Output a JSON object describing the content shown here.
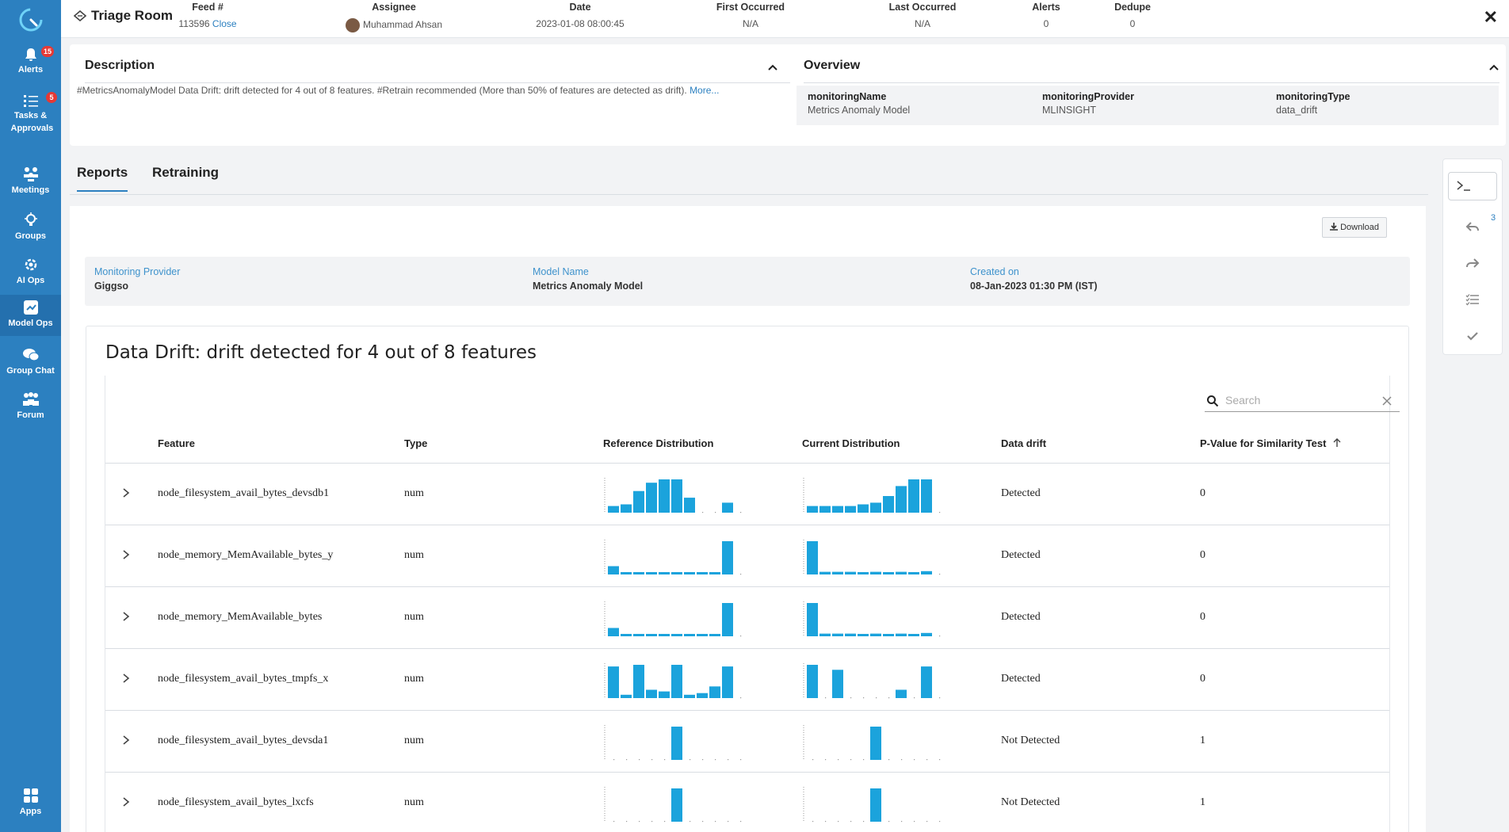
{
  "sidebar": {
    "items": [
      {
        "label": "Alerts",
        "badge": "15"
      },
      {
        "label": "Tasks & Approvals",
        "badge": "5"
      },
      {
        "label": "Meetings"
      },
      {
        "label": "Groups"
      },
      {
        "label": "AI Ops"
      },
      {
        "label": "Model Ops"
      },
      {
        "label": "Group Chat"
      },
      {
        "label": "Forum"
      },
      {
        "label": "Apps"
      }
    ]
  },
  "header": {
    "title": "Triage Room",
    "feed": {
      "label": "Feed #",
      "value": "113596",
      "action": "Close"
    },
    "assignee": {
      "label": "Assignee",
      "value": "Muhammad Ahsan"
    },
    "date": {
      "label": "Date",
      "value": "2023-01-08 08:00:45"
    },
    "first_occurred": {
      "label": "First Occurred",
      "value": "N/A"
    },
    "last_occurred": {
      "label": "Last Occurred",
      "value": "N/A"
    },
    "alerts": {
      "label": "Alerts",
      "value": "0"
    },
    "dedupe": {
      "label": "Dedupe",
      "value": "0"
    }
  },
  "description": {
    "title": "Description",
    "text": "#MetricsAnomalyModel Data Drift: drift detected for 4 out of 8 features. #Retrain recommended (More than 50% of features are detected as drift).",
    "more": "More..."
  },
  "overview": {
    "title": "Overview",
    "fields": [
      {
        "key": "monitoringName",
        "value": "Metrics Anomaly Model"
      },
      {
        "key": "monitoringProvider",
        "value": "MLINSIGHT"
      },
      {
        "key": "monitoringType",
        "value": "data_drift"
      }
    ]
  },
  "tabs": [
    {
      "label": "Reports"
    },
    {
      "label": "Retraining"
    }
  ],
  "report": {
    "download_label": "Download",
    "meta": [
      {
        "key": "Monitoring Provider",
        "value": "Giggso"
      },
      {
        "key": "Model Name",
        "value": "Metrics Anomaly Model"
      },
      {
        "key": "Created on",
        "value": "08-Jan-2023 01:30 PM (IST)"
      }
    ],
    "drift_title": "Data Drift: drift detected for 4 out of 8 features",
    "search_placeholder": "Search",
    "columns": [
      "Feature",
      "Type",
      "Reference Distribution",
      "Current Distribution",
      "Data drift",
      "P-Value for Similarity Test"
    ],
    "rows": [
      {
        "feature": "node_filesystem_avail_bytes_devsdb1",
        "type": "num",
        "drift": "Detected",
        "pvalue": "0",
        "ref": [
          0.2,
          0.25,
          0.65,
          0.9,
          1.0,
          1.0,
          0.45,
          0,
          0,
          0.3,
          0
        ],
        "cur": [
          0.2,
          0.2,
          0.2,
          0.2,
          0.25,
          0.3,
          0.5,
          0.8,
          1.0,
          1.0,
          0
        ]
      },
      {
        "feature": "node_memory_MemAvailable_bytes_y",
        "type": "num",
        "drift": "Detected",
        "pvalue": "0",
        "ref": [
          0.25,
          0.05,
          0.05,
          0.05,
          0.05,
          0.05,
          0.05,
          0.05,
          0.05,
          1.0,
          0
        ],
        "cur": [
          1.0,
          0.08,
          0.08,
          0.08,
          0.06,
          0.08,
          0.06,
          0.08,
          0.06,
          0.1,
          0
        ]
      },
      {
        "feature": "node_memory_MemAvailable_bytes",
        "type": "num",
        "drift": "Detected",
        "pvalue": "0",
        "ref": [
          0.25,
          0.05,
          0.05,
          0.05,
          0.05,
          0.05,
          0.05,
          0.05,
          0.05,
          1.0,
          0
        ],
        "cur": [
          1.0,
          0.08,
          0.08,
          0.08,
          0.06,
          0.08,
          0.06,
          0.08,
          0.06,
          0.1,
          0
        ]
      },
      {
        "feature": "node_filesystem_avail_bytes_tmpfs_x",
        "type": "num",
        "drift": "Detected",
        "pvalue": "0",
        "ref": [
          0.95,
          0.1,
          1.0,
          0.25,
          0.2,
          1.0,
          0.1,
          0.15,
          0.35,
          0.95,
          0
        ],
        "cur": [
          1.0,
          0,
          0.85,
          0,
          0,
          0,
          0,
          0.25,
          0,
          0.95,
          0
        ]
      },
      {
        "feature": "node_filesystem_avail_bytes_devsda1",
        "type": "num",
        "drift": "Not Detected",
        "pvalue": "1",
        "ref": [
          0,
          0,
          0,
          0,
          0,
          1.0,
          0,
          0,
          0,
          0,
          0
        ],
        "cur": [
          0,
          0,
          0,
          0,
          0,
          1.0,
          0,
          0,
          0,
          0,
          0
        ]
      },
      {
        "feature": "node_filesystem_avail_bytes_lxcfs",
        "type": "num",
        "drift": "Not Detected",
        "pvalue": "1",
        "ref": [
          0,
          0,
          0,
          0,
          0,
          1.0,
          0,
          0,
          0,
          0,
          0
        ],
        "cur": [
          0,
          0,
          0,
          0,
          0,
          1.0,
          0,
          0,
          0,
          0,
          0
        ]
      }
    ]
  },
  "right_panel": {
    "count": "3"
  },
  "colors": {
    "sidebar": "#2c80c0",
    "accent": "#2c80c0",
    "bars": "#1ba3dc",
    "badge": "#e53935"
  }
}
